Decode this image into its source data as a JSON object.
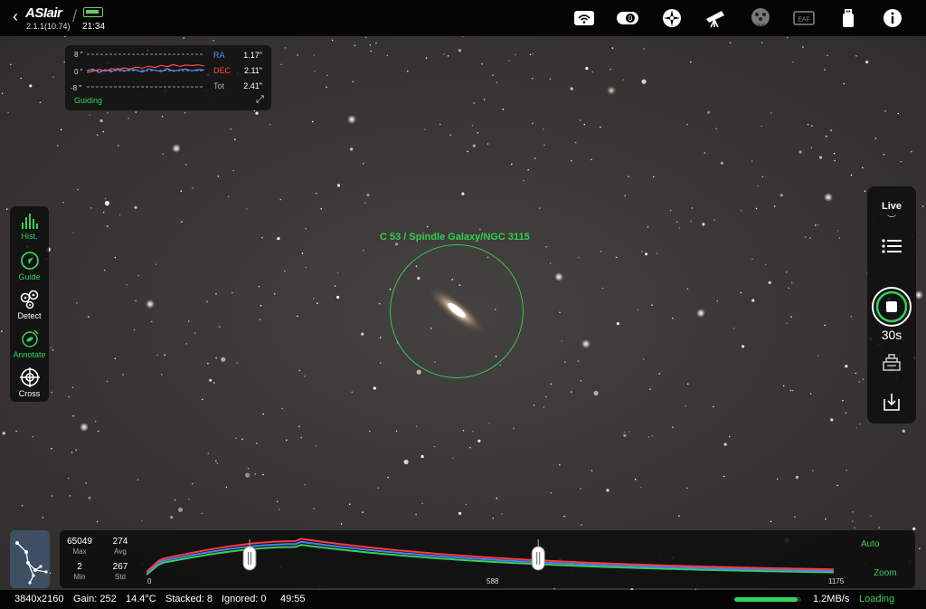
{
  "app": {
    "brand": "ASIair",
    "version": "2.1.1(10.74)",
    "time": "21:34"
  },
  "toolbar_icons": [
    "wifi-icon",
    "camera-icon",
    "mount-icon",
    "telescope-icon",
    "filter-wheel-icon",
    "focuser-icon",
    "usb-icon",
    "info-icon"
  ],
  "toolbar_badges": {
    "filter_wheel": "EFW",
    "focuser": "EAF"
  },
  "guide": {
    "axis_top": "8 \"",
    "axis_mid": "0 \"",
    "axis_bot": "-8 \"",
    "ra_label": "RA",
    "ra_value": "1.17\"",
    "dec_label": "DEC",
    "dec_value": "2.11\"",
    "tot_label": "Tot",
    "tot_value": "2.41\"",
    "status": "Guiding",
    "colors": {
      "ra": "#4a8cff",
      "dec": "#ff4a3a"
    },
    "ra_series": [
      0,
      0.6,
      -0.8,
      0.4,
      -0.5,
      0.9,
      -0.3,
      0.5,
      0.2,
      -0.6,
      0.7,
      0.1,
      -0.4,
      0.8,
      -0.2,
      0.3,
      0.6,
      -0.1,
      0.4,
      0.2
    ],
    "dec_series": [
      -0.8,
      -0.3,
      0.5,
      -0.2,
      0.8,
      0.3,
      1.1,
      0.6,
      1.4,
      1.0,
      1.8,
      1.2,
      2.1,
      1.6,
      2.4,
      1.7,
      2.2,
      2.0,
      2.3,
      1.9
    ]
  },
  "left_tools": [
    {
      "label": "Hist.",
      "icon": "histogram-icon",
      "active": true
    },
    {
      "label": "Guide",
      "icon": "guide-icon",
      "active": true
    },
    {
      "label": "Detect",
      "icon": "detect-icon",
      "active": false
    },
    {
      "label": "Annotate",
      "icon": "annotate-icon",
      "active": true
    },
    {
      "label": "Cross",
      "icon": "crosshair-icon",
      "active": false
    }
  ],
  "annotation": {
    "label": "C 53 / Spindle Galaxy/NGC 3115"
  },
  "right_panel": {
    "mode": "Live",
    "exposure": "30s",
    "icons": [
      "list-icon",
      "stop-icon",
      "stack-icon",
      "save-icon"
    ]
  },
  "histogram": {
    "max_value": "65049",
    "max_label": "Max",
    "avg_value": "274",
    "avg_label": "Avg",
    "min_value": "2",
    "min_label": "Min",
    "std_value": "267",
    "std_label": "Std",
    "axis_start": "0",
    "axis_mid": "588",
    "axis_end": "1175",
    "auto": "Auto",
    "zoom": "Zoom",
    "stretch_low": 0.15,
    "stretch_high": 0.57
  },
  "status": {
    "resolution": "3840x2160",
    "gain": "Gain: 252",
    "temp": "14.4°C",
    "stacked": "Stacked: 8",
    "ignored": "Ignored: 0",
    "elapsed": "49:55",
    "progress": 0.95,
    "speed": "1.2MB/s",
    "state": "Loading"
  }
}
